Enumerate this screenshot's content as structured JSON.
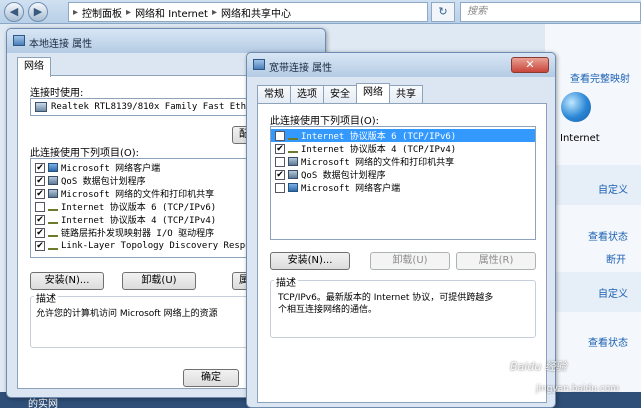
{
  "explorer": {
    "back": "◀",
    "forward": "▶",
    "breadcrumb": [
      "控制面板",
      "网络和 Internet",
      "网络和共享中心"
    ],
    "refresh": "↻",
    "search_placeholder": "搜索",
    "right_links": {
      "view_full_map": "查看完整映射",
      "internet": "Internet",
      "customize1": "自定义",
      "view_status1": "查看状态",
      "disconnect": "断开",
      "customize2": "自定义",
      "view_status2": "查看状态"
    },
    "bottom_left_text": "的实网"
  },
  "local_dialog": {
    "title": "本地连接 属性",
    "tab": "网络",
    "connect_using_label": "连接时使用:",
    "adapter": "Realtek RTL8139/810x Family Fast Ether",
    "configure_button": "配",
    "items_label": "此连接使用下列项目(O):",
    "items": [
      {
        "checked": true,
        "icon": "client",
        "label": "Microsoft 网络客户端"
      },
      {
        "checked": true,
        "icon": "service",
        "label": "QoS 数据包计划程序"
      },
      {
        "checked": true,
        "icon": "service",
        "label": "Microsoft 网络的文件和打印机共享"
      },
      {
        "checked": false,
        "icon": "protocol",
        "label": "Internet 协议版本 6 (TCP/IPv6)"
      },
      {
        "checked": true,
        "icon": "protocol",
        "label": "Internet 协议版本 4 (TCP/IPv4)"
      },
      {
        "checked": true,
        "icon": "protocol",
        "label": "链路层拓扑发现映射器 I/O 驱动程序"
      },
      {
        "checked": true,
        "icon": "protocol",
        "label": "Link-Layer Topology Discovery Respon"
      }
    ],
    "install_button": "安装(N)...",
    "uninstall_button": "卸载(U)",
    "properties_button": "属",
    "description_title": "描述",
    "description_text": "允许您的计算机访问 Microsoft 网络上的资源",
    "ok_button": "确定"
  },
  "broadband_dialog": {
    "title": "宽带连接 属性",
    "tabs": [
      "常规",
      "选项",
      "安全",
      "网络",
      "共享"
    ],
    "active_tab": "网络",
    "items_label": "此连接使用下列项目(O):",
    "items": [
      {
        "checked": false,
        "selected": true,
        "icon": "protocol",
        "label": "Internet 协议版本 6 (TCP/IPv6)"
      },
      {
        "checked": true,
        "selected": false,
        "icon": "protocol",
        "label": "Internet 协议版本 4 (TCP/IPv4)"
      },
      {
        "checked": false,
        "selected": false,
        "icon": "service",
        "label": "Microsoft 网络的文件和打印机共享"
      },
      {
        "checked": true,
        "selected": false,
        "icon": "service",
        "label": "QoS 数据包计划程序"
      },
      {
        "checked": false,
        "selected": false,
        "icon": "client",
        "label": "Microsoft 网络客户端"
      }
    ],
    "install_button": "安装(N)...",
    "uninstall_button": "卸载(U)",
    "properties_button": "属性(R)",
    "description_title": "描述",
    "description_line1": "TCP/IPv6。最新版本的 Internet 协议，可提供跨越多",
    "description_line2": "个相互连接网络的通信。"
  },
  "watermark": {
    "line1": "Baidu 经验",
    "line2": "jingyan.baidu.com"
  },
  "colors": {
    "selection": "#3399ff",
    "link": "#1a5fb4",
    "close": "#c9443a"
  }
}
